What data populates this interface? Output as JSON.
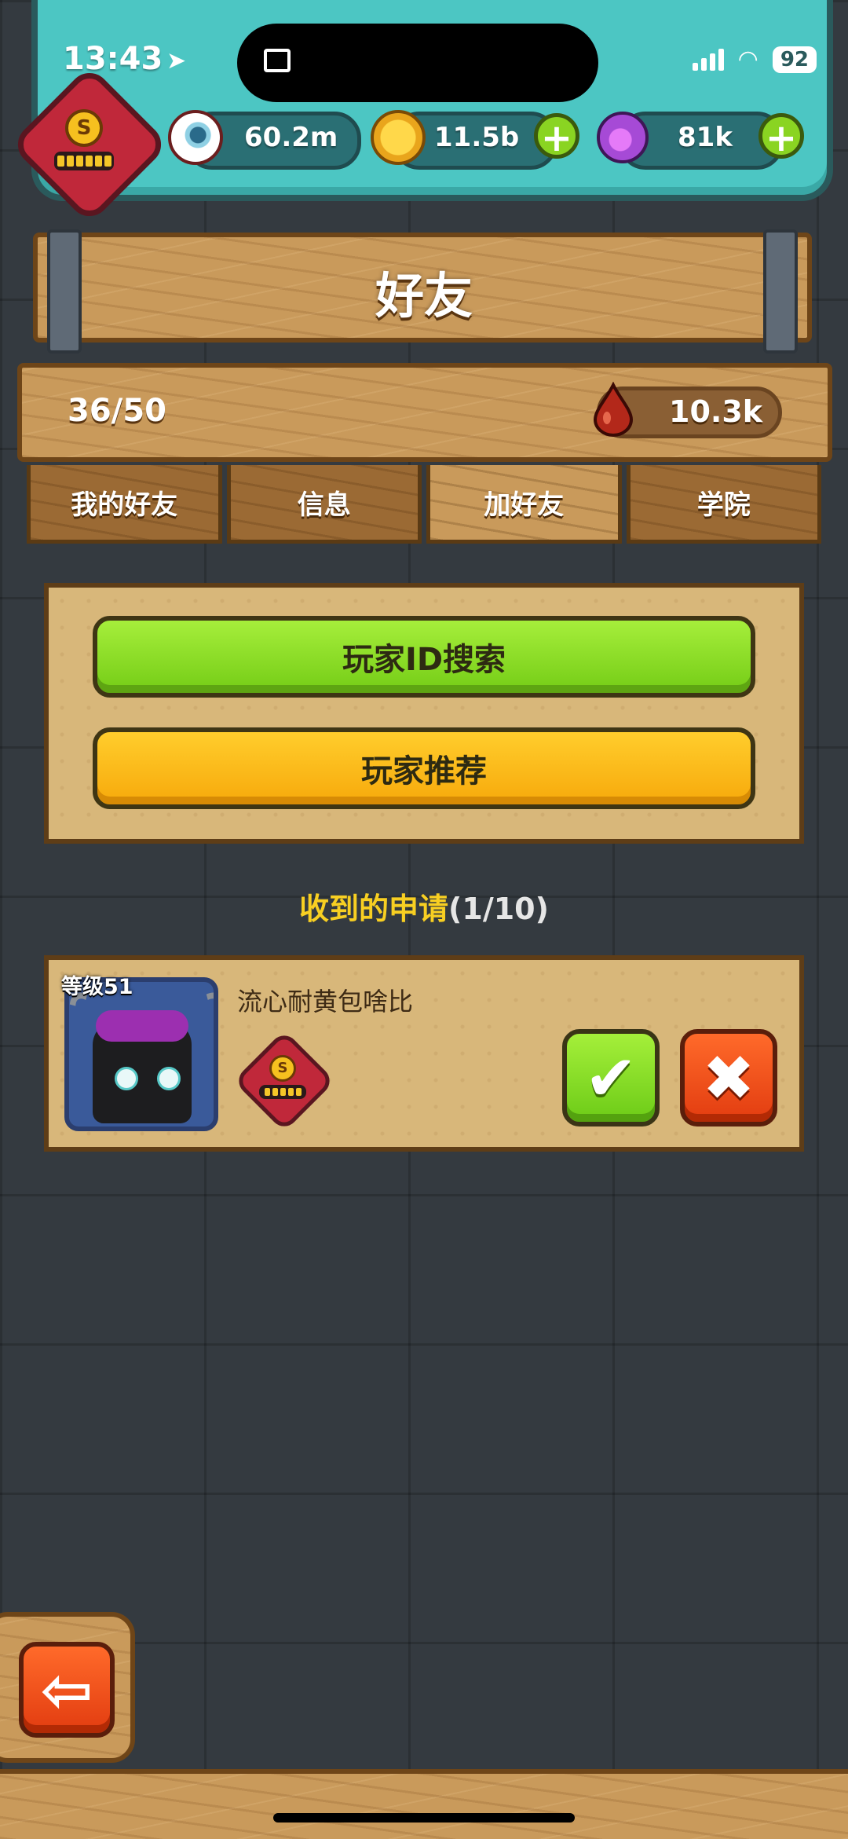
{
  "status_bar": {
    "time": "13:43",
    "battery": "92"
  },
  "currencies": {
    "eyes": "60.2m",
    "gold": "11.5b",
    "potion": "81k"
  },
  "title": "好友",
  "friends": {
    "count": "36/50",
    "blood": "10.3k"
  },
  "tabs": [
    {
      "label": "我的好友",
      "active": false
    },
    {
      "label": "信息",
      "active": false
    },
    {
      "label": "加好友",
      "active": true
    },
    {
      "label": "学院",
      "active": false
    }
  ],
  "search": {
    "id_search_label": "玩家ID搜索",
    "recommend_label": "玩家推荐"
  },
  "requests": {
    "title": "收到的申请",
    "count": "(1/10)",
    "items": [
      {
        "level": "等级51",
        "name": "流心耐黄包啥比",
        "badge_letter": "S"
      }
    ]
  },
  "player_badge": {
    "letter": "S"
  },
  "icons": {
    "accept": "check-icon",
    "reject": "close-icon",
    "back": "arrow-left-icon",
    "add": "plus-icon"
  },
  "colors": {
    "accent_green": "#8ad422",
    "accent_yellow": "#ffc21a",
    "accent_red": "#e23c10",
    "teal_panel": "#4cc6c3"
  }
}
